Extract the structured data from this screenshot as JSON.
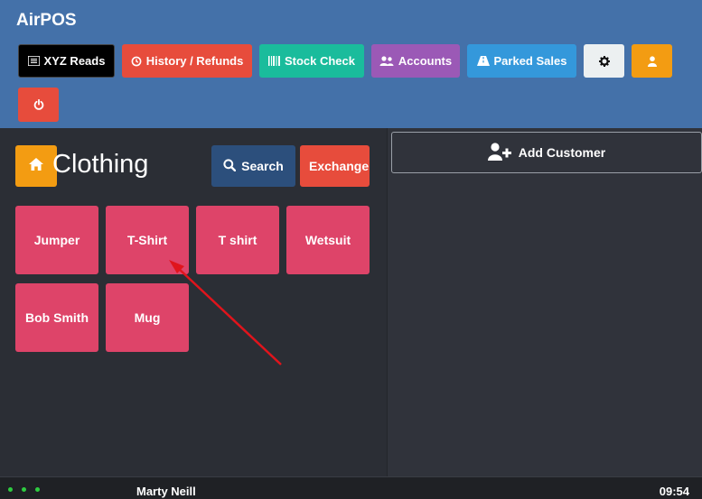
{
  "app": {
    "title": "AirPOS"
  },
  "toolbar": {
    "xyz_reads": "XYZ Reads",
    "history_refunds": "History / Refunds",
    "stock_check": "Stock Check",
    "accounts": "Accounts",
    "parked_sales": "Parked Sales"
  },
  "category": {
    "title": "Clothing",
    "search_label": "Search",
    "exchange_label": "Exchange"
  },
  "products": [
    "Jumper",
    "T-Shirt",
    "T shirt",
    "Wetsuit",
    "Bob Smith",
    "Mug"
  ],
  "customer": {
    "add_label": "Add Customer"
  },
  "footer": {
    "user": "Marty Neill",
    "time": "09:54"
  },
  "colors": {
    "header_bg": "#4471a9",
    "xyz_reads": "#000000",
    "history_refunds": "#e74c3c",
    "stock_check": "#1abc9c",
    "accounts": "#9b59b6",
    "parked_sales": "#3498db",
    "settings": "#ecf0f1",
    "user": "#f39c12",
    "power": "#e74c3c",
    "product_tile": "#de4469",
    "annotation_arrow": "#e0141c"
  },
  "icons": {
    "xyz_reads": "list-icon",
    "history_refunds": "history-icon",
    "stock_check": "barcode-icon",
    "accounts": "users-icon",
    "parked_sales": "road-icon",
    "settings": "gear-icon",
    "user": "user-icon",
    "power": "power-icon",
    "home": "home-icon",
    "search": "search-icon",
    "add_customer": "user-plus-icon"
  }
}
